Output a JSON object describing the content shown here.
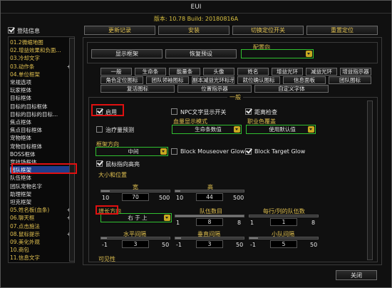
{
  "window": {
    "title": "EUI",
    "version_text": "版本: 10.78 Build: 20180816A"
  },
  "header": {
    "login_info_label": "登陆信息",
    "buttons": [
      "更新记录",
      "安装",
      "切换定位开关",
      "重置定位"
    ]
  },
  "sidebar": {
    "items": [
      {
        "label": "01.2微缩地图",
        "color": "gold",
        "expand": ""
      },
      {
        "label": "02.增益效果和负面...",
        "color": "gold",
        "expand": ""
      },
      {
        "label": "03.冷却文字",
        "color": "gold",
        "expand": ""
      },
      {
        "label": "03.动作条",
        "color": "gold",
        "expand": "+"
      },
      {
        "label": "04.单位框架",
        "color": "gold",
        "expand": "-"
      },
      {
        "label": "常规选项",
        "color": "white",
        "expand": ""
      },
      {
        "label": "玩家框体",
        "color": "white",
        "expand": ""
      },
      {
        "label": "目标框体",
        "color": "white",
        "expand": ""
      },
      {
        "label": "目标的目标框体",
        "color": "white",
        "expand": ""
      },
      {
        "label": "目标的目标的目标...",
        "color": "white",
        "expand": ""
      },
      {
        "label": "焦点框体",
        "color": "white",
        "expand": ""
      },
      {
        "label": "焦点目标框体",
        "color": "white",
        "expand": ""
      },
      {
        "label": "宠物框体",
        "color": "white",
        "expand": ""
      },
      {
        "label": "宠物目标框体",
        "color": "white",
        "expand": ""
      },
      {
        "label": "BOSS框体",
        "color": "white",
        "expand": ""
      },
      {
        "label": "竞技场框体",
        "color": "white",
        "expand": ""
      },
      {
        "label": "团队框架",
        "color": "white",
        "expand": "",
        "selected": true
      },
      {
        "label": "队伍框体",
        "color": "white",
        "expand": ""
      },
      {
        "label": "团队宠物名字",
        "color": "white",
        "expand": ""
      },
      {
        "label": "助理框架",
        "color": "white",
        "expand": ""
      },
      {
        "label": "坦克框架",
        "color": "white",
        "expand": ""
      },
      {
        "label": "05.姓名板(血条)",
        "color": "gold",
        "expand": "+"
      },
      {
        "label": "06.聊天框",
        "color": "gold",
        "expand": "+"
      },
      {
        "label": "07.点击施法",
        "color": "gold",
        "expand": ""
      },
      {
        "label": "08.鼠标提示",
        "color": "gold",
        "expand": "+"
      },
      {
        "label": "09.美化外观",
        "color": "gold",
        "expand": ""
      },
      {
        "label": "10.商包",
        "color": "gold",
        "expand": ""
      },
      {
        "label": "11.信息文字",
        "color": "gold",
        "expand": ""
      }
    ]
  },
  "top_panel": {
    "config_label": "配置向",
    "show_frame_btn": "显示框架",
    "restore_btn": "恢复预设",
    "config_value": ""
  },
  "tabs_row1": [
    "一般",
    "生命条",
    "能量条",
    "头像",
    "姓名",
    "增益光环",
    "减益光环",
    "增益指示器"
  ],
  "tabs_row2": [
    "角色定位图标",
    "团队领袖图标",
    "副本减益光环标示",
    "就位确认图标",
    "信息面板",
    "团队图标"
  ],
  "tabs_row3": [
    "复活图标",
    "位置指示器",
    "自定义字体"
  ],
  "general": {
    "section_title": "一般",
    "enable_label": "启用",
    "npc_text_label": "NPC文字显示开关",
    "range_check_label": "距离检查",
    "heal_predict_label": "治疗量预测",
    "health_mode_label": "血量显示模式",
    "health_mode_value": "生命条数值",
    "class_color_label": "职业色覆盖",
    "class_color_value": "使用默认值",
    "frame_dir_label": "框架方向",
    "frame_dir_value": "中间",
    "block_mouseover_label": "Block Mouseover Glow",
    "block_target_label": "Block Target Glow",
    "mouse_highlight_label": "鼠标指向高亮",
    "size_pos_label": "大小和位置",
    "width_label": "宽",
    "width_min": "10",
    "width_val": "70",
    "width_max": "500",
    "width_frac": 0.12,
    "height_label": "高",
    "height_min": "10",
    "height_val": "44",
    "height_max": "500",
    "height_frac": 0.07,
    "grow_dir_label": "增长方向",
    "grow_dir_value": "右 于 上",
    "group_count_label": "队伍数目",
    "group_count_min": "1",
    "group_count_val": "8",
    "group_count_max": "8",
    "group_count_frac": 1.0,
    "per_row_label": "每行/列的队伍数",
    "per_row_min": "1",
    "per_row_val": "1",
    "per_row_max": "8",
    "per_row_frac": 0.0,
    "hspace_label": "水平间隔",
    "hspace_min": "-1",
    "hspace_val": "3",
    "hspace_max": "50",
    "hspace_frac": 0.08,
    "vspace_label": "垂直间隔",
    "vspace_min": "-1",
    "vspace_val": "3",
    "vspace_max": "50",
    "vspace_frac": 0.08,
    "small_space_label": "小队间隔",
    "small_space_min": "-1",
    "small_space_val": "5",
    "small_space_max": "50",
    "small_space_frac": 0.12,
    "visibility_label": "可见性"
  },
  "footer": {
    "close_btn": "关闭"
  }
}
